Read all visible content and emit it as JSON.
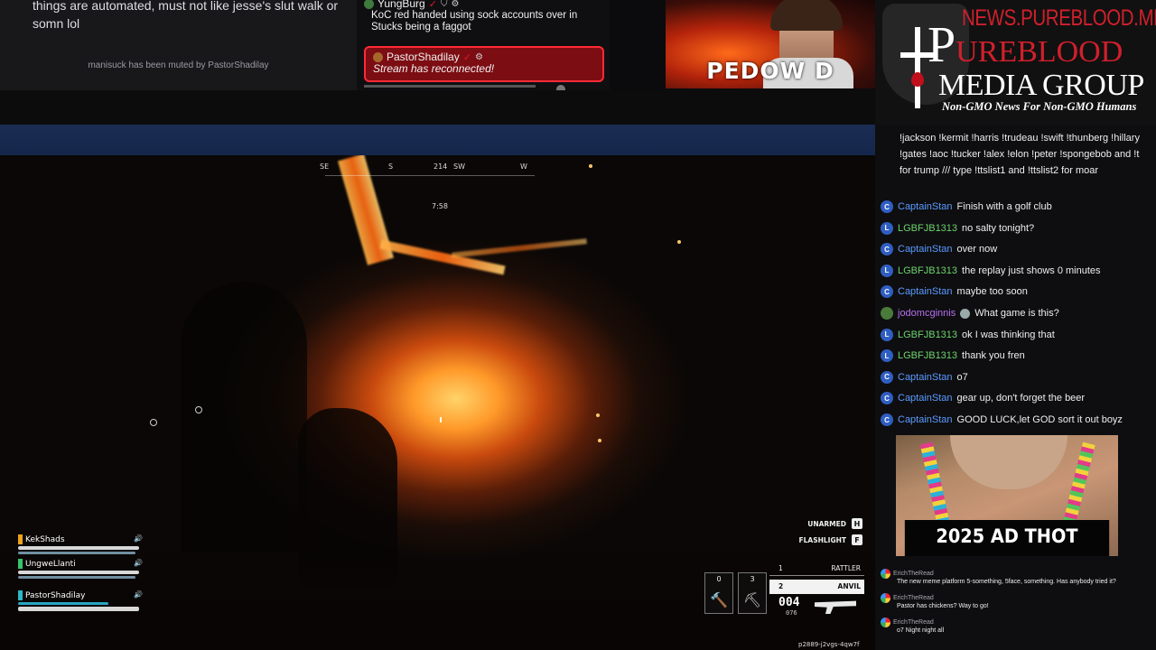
{
  "top_left_chat": {
    "message": "things are automated, must not like jesse's slut walk or somn lol",
    "muted_notice": "manisuck has been muted by PastorShadilay"
  },
  "top_mid_chat": {
    "entries": [
      {
        "user": "YungBurg",
        "text": "KoC red handed using sock accounts over in Stucks being a faggot"
      },
      {
        "user": "PastorShadilay",
        "text": "Stream has reconnected!"
      }
    ],
    "check_icon": "✓",
    "gear_icon": "⚙",
    "shield_icon": "⛉"
  },
  "thumbnail": {
    "label": "PEDOW  D"
  },
  "logo": {
    "site": "NEWS.PUREBLOOD.MEDIA",
    "pure": "P",
    "pure_rest": "UREBLOOD",
    "media": "MEDIA GROUP",
    "tagline": "Non-GMO News For Non-GMO Humans"
  },
  "game": {
    "compass": [
      "SE",
      "S",
      "214",
      "SW",
      "W"
    ],
    "timer": "7:58",
    "squad": [
      {
        "name": "KekShads",
        "color": "#f0a21c",
        "health": 1.0
      },
      {
        "name": "UngweLlanti",
        "color": "#38c46a",
        "health": 1.0
      },
      {
        "name": "PastorShadilay",
        "color": "#2bb8c8",
        "health": 1.0
      }
    ],
    "speaker_icon": "🔊",
    "keys": [
      {
        "label": "UNARMED",
        "key": "H"
      },
      {
        "label": "FLASHLIGHT",
        "key": "F"
      }
    ],
    "tools": [
      {
        "num": "0",
        "icon": "🔨"
      },
      {
        "num": "3",
        "icon": "⛏"
      }
    ],
    "weapons": [
      {
        "slot": "1",
        "name": "RATTLER"
      },
      {
        "slot": "2",
        "name": "ANVIL"
      }
    ],
    "ammo": "004",
    "ammo_reserve": "076",
    "session_id": "p2889-j2vgs-4qw7f"
  },
  "right_chat": {
    "command_list": "!jackson !kermit !harris !trudeau !swift !thunberg !hillary !gates !aoc !tucker !alex !elon !peter !spongebob and !t for trump /// type !ttslist1 and !ttslist2 for moar",
    "messages": [
      {
        "badge": "C",
        "user": "CaptainStan",
        "color": "#5b9bff",
        "text": "Finish with a golf club"
      },
      {
        "badge": "L",
        "user": "LGBFJB1313",
        "color": "#6cd46c",
        "text": "no salty tonight?"
      },
      {
        "badge": "C",
        "user": "CaptainStan",
        "color": "#5b9bff",
        "text": "over now"
      },
      {
        "badge": "L",
        "user": "LGBFJB1313",
        "color": "#6cd46c",
        "text": "the replay just shows 0 minutes"
      },
      {
        "badge": "C",
        "user": "CaptainStan",
        "color": "#5b9bff",
        "text": "maybe too soon"
      },
      {
        "badge": "",
        "user": "jodomcginnis",
        "color": "#b96ef2",
        "text": "What game is this?"
      },
      {
        "badge": "L",
        "user": "LGBFJB1313",
        "color": "#6cd46c",
        "text": "ok I was thinking that"
      },
      {
        "badge": "L",
        "user": "LGBFJB1313",
        "color": "#6cd46c",
        "text": "thank you fren"
      },
      {
        "badge": "C",
        "user": "CaptainStan",
        "color": "#5b9bff",
        "text": "o7"
      },
      {
        "badge": "C",
        "user": "CaptainStan",
        "color": "#5b9bff",
        "text": "gear up, don't forget the beer"
      },
      {
        "badge": "C",
        "user": "CaptainStan",
        "color": "#5b9bff",
        "text": "GOOD LUCK,let GOD sort it out boyz"
      }
    ],
    "ad_caption": "2025 AD THOT",
    "small_messages": [
      {
        "user": "ErichTheRead",
        "text": "The new meme platform 5-something, 5face, something. Has anybody tried it?"
      },
      {
        "user": "ErichTheRead",
        "text": "Pastor has chickens? Way to go!"
      },
      {
        "user": "ErichTheRead",
        "text": "o7 Night night all"
      }
    ]
  }
}
